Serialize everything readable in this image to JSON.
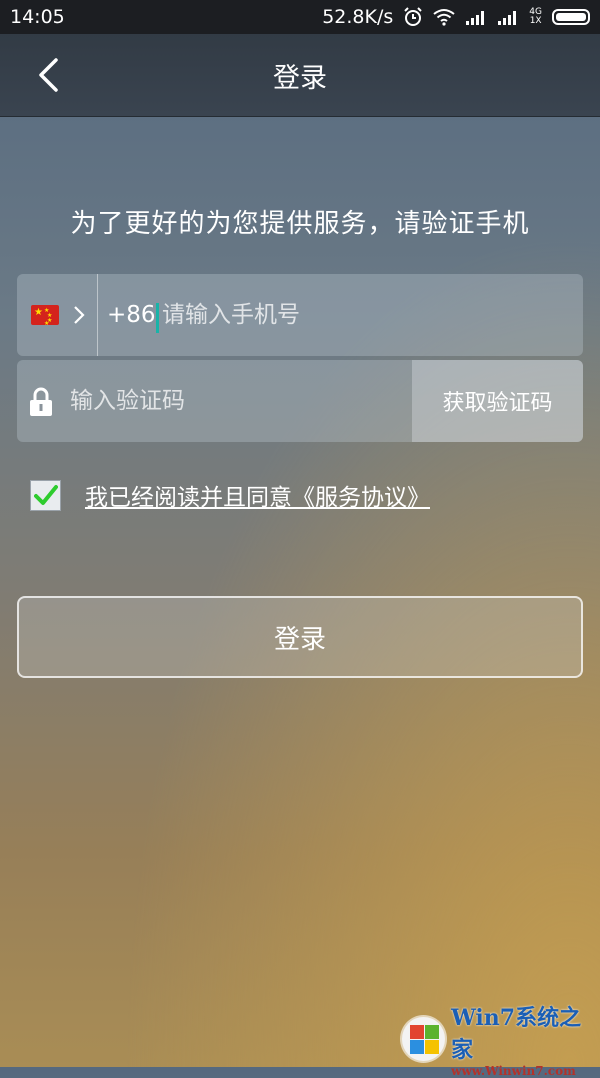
{
  "status": {
    "time": "14:05",
    "speed": "52.8K/s",
    "net_top": "4G",
    "net_bottom": "1X"
  },
  "header": {
    "title": "登录"
  },
  "subtitle": "为了更好的为您提供服务，请验证手机",
  "phone": {
    "country_code": "+86",
    "placeholder": "请输入手机号"
  },
  "code": {
    "placeholder": "输入验证码",
    "get_code_label": "获取验证码"
  },
  "agreement": {
    "checked": true,
    "text": "我已经阅读并且同意《服务协议》"
  },
  "login_label": "登录",
  "watermark": {
    "brand": "Win7系统之家",
    "url": "www.Winwin7.com"
  },
  "icons": [
    "back-arrow-icon",
    "china-flag-icon",
    "chevron-right-icon",
    "lock-icon",
    "checkmark-icon",
    "alarm-icon",
    "wifi-icon",
    "signal-icon",
    "battery-icon"
  ],
  "colors": {
    "cursor": "#19b3a8",
    "check": "#2ecc2e",
    "title_bar": "#323b45",
    "status_bar": "#1c1e22"
  }
}
